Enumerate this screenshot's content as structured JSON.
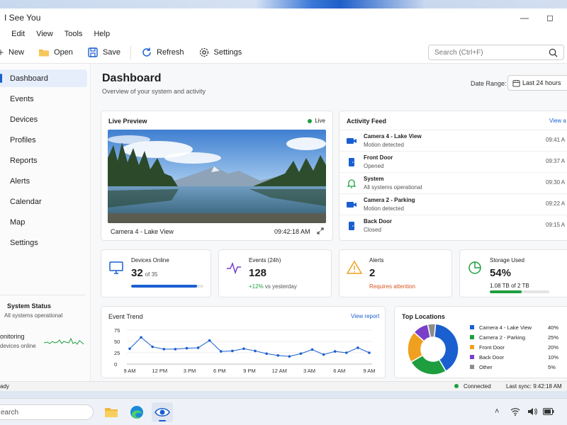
{
  "app": {
    "title": "I See You"
  },
  "menu": [
    "Edit",
    "View",
    "Tools",
    "Help"
  ],
  "menu_first": "e",
  "toolbar": {
    "new": "New",
    "open": "Open",
    "save": "Save",
    "refresh": "Refresh",
    "settings": "Settings",
    "search_placeholder": "Search (Ctrl+F)"
  },
  "sidebar": {
    "items": [
      {
        "label": "Dashboard",
        "icon": "dashboard-icon"
      },
      {
        "label": "Events",
        "icon": "events-icon"
      },
      {
        "label": "Devices",
        "icon": "devices-icon"
      },
      {
        "label": "Profiles",
        "icon": "profiles-icon"
      },
      {
        "label": "Reports",
        "icon": "reports-icon"
      },
      {
        "label": "Alerts",
        "icon": "alerts-icon"
      },
      {
        "label": "Calendar",
        "icon": "calendar-icon"
      },
      {
        "label": "Map",
        "icon": "map-icon"
      },
      {
        "label": "Settings",
        "icon": "settings-icon"
      }
    ],
    "system_status_title": "System Status",
    "system_status_text": "All systems operational",
    "monitoring_title": "onitoring",
    "monitoring_text": "devices online"
  },
  "dashboard": {
    "title": "Dashboard",
    "subtitle": "Overview of your system and activity",
    "date_range_label": "Date Range:",
    "date_range_value": "Last 24 hours"
  },
  "preview": {
    "title": "Live Preview",
    "live": "Live",
    "camera": "Camera 4 - Lake View",
    "time": "09:42:18 AM"
  },
  "feed": {
    "title": "Activity Feed",
    "view_all": "View a",
    "items": [
      {
        "title": "Camera 4 - Lake View",
        "desc": "Motion detected",
        "time": "09:41 A",
        "icon": "camera-icon"
      },
      {
        "title": "Front Door",
        "desc": "Opened",
        "time": "09:37 A",
        "icon": "door-icon"
      },
      {
        "title": "System",
        "desc": "All systems operational",
        "time": "09:30 A",
        "icon": "bell-icon"
      },
      {
        "title": "Camera 2 - Parking",
        "desc": "Motion detected",
        "time": "09:22 A",
        "icon": "camera-icon"
      },
      {
        "title": "Back Door",
        "desc": "Closed",
        "time": "09:15 A",
        "icon": "door-icon"
      }
    ]
  },
  "stats": {
    "devices": {
      "label": "Devices Online",
      "value": "32",
      "of": "of 35",
      "fraction": 0.914
    },
    "events": {
      "label": "Events (24h)",
      "value": "128",
      "note": "+12%",
      "note_rest": "vs yesterday"
    },
    "alerts": {
      "label": "Alerts",
      "value": "2",
      "note": "Requires attention"
    },
    "storage": {
      "label": "Storage Used",
      "value": "54%",
      "note": "1.08 TB of 2 TB",
      "fraction": 0.54
    }
  },
  "trend": {
    "title": "Event Trend",
    "link": "View report"
  },
  "chart_data": {
    "type": "line",
    "x_ticks": [
      "9 AM",
      "12 PM",
      "3 PM",
      "6 PM",
      "9 PM",
      "12 AM",
      "3 AM",
      "6 AM",
      "9 AM"
    ],
    "y_ticks": [
      0,
      25,
      50,
      75
    ],
    "ylim": [
      0,
      75
    ],
    "values": [
      34,
      59,
      38,
      33,
      33,
      35,
      36,
      52,
      28,
      29,
      34,
      29,
      23,
      19,
      17,
      23,
      32,
      21,
      28,
      25,
      36,
      25
    ],
    "color": "#1a5fd0"
  },
  "locations": {
    "title": "Top Locations",
    "items": [
      {
        "name": "Camera 4 - Lake View",
        "pct": "40%",
        "value": 40,
        "color": "#1a5fd0"
      },
      {
        "name": "Camera 2 - Parking",
        "pct": "25%",
        "value": 25,
        "color": "#1e9e3e"
      },
      {
        "name": "Front Door",
        "pct": "20%",
        "value": 20,
        "color": "#f0a020"
      },
      {
        "name": "Back Door",
        "pct": "10%",
        "value": 10,
        "color": "#7a3fc8"
      },
      {
        "name": "Other",
        "pct": "5%",
        "value": 5,
        "color": "#8c8c8c"
      }
    ]
  },
  "status": {
    "left": "ady",
    "connected": "Connected",
    "sync": "Last sync: 9:42:18 AM"
  },
  "taskbar": {
    "search": "earch"
  }
}
